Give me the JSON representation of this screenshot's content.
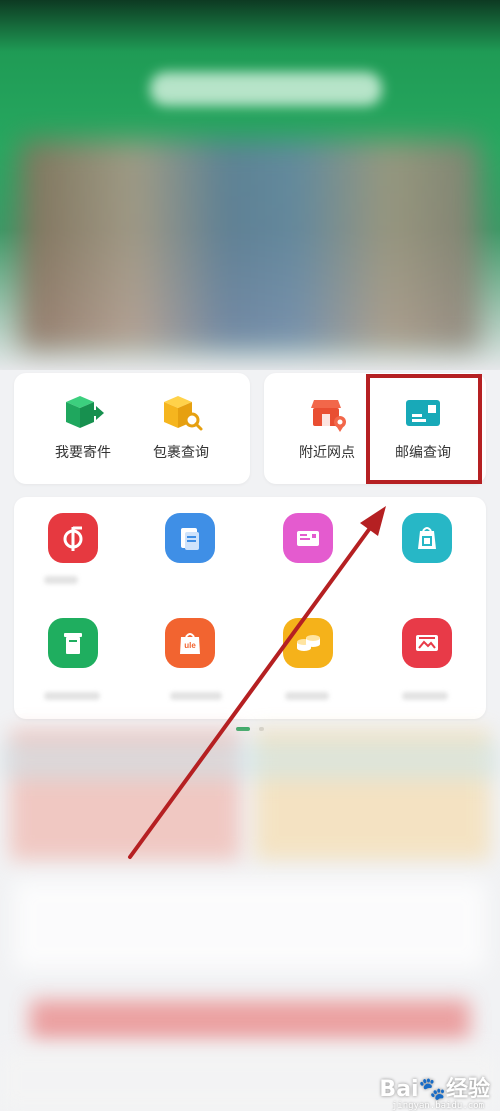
{
  "services": [
    {
      "label": "我要寄件",
      "icon": "send-package-icon"
    },
    {
      "label": "包裹查询",
      "icon": "package-search-icon"
    },
    {
      "label": "附近网点",
      "icon": "nearby-outlet-icon"
    },
    {
      "label": "邮编查询",
      "icon": "postcode-lookup-icon"
    }
  ],
  "apps": [
    {
      "icon": "post-logo-icon",
      "color": "#e63940"
    },
    {
      "icon": "document-icon",
      "color": "#3f8fe6"
    },
    {
      "icon": "envelope-icon",
      "color": "#e45bcf"
    },
    {
      "icon": "bag-icon",
      "color": "#27b7c6"
    },
    {
      "icon": "mailbox-icon",
      "color": "#1fae5f"
    },
    {
      "icon": "ule-shop-icon",
      "color": "#f26430"
    },
    {
      "icon": "coins-icon",
      "color": "#f5b21a"
    },
    {
      "icon": "picture-card-icon",
      "color": "#e83a48"
    }
  ],
  "watermark": {
    "brand": "Bai",
    "suffix": "经验",
    "url": "jingyan.baidu.com"
  },
  "colors": {
    "highlight": "#b52022",
    "arrow": "#b52022",
    "green": "#25a55e"
  }
}
